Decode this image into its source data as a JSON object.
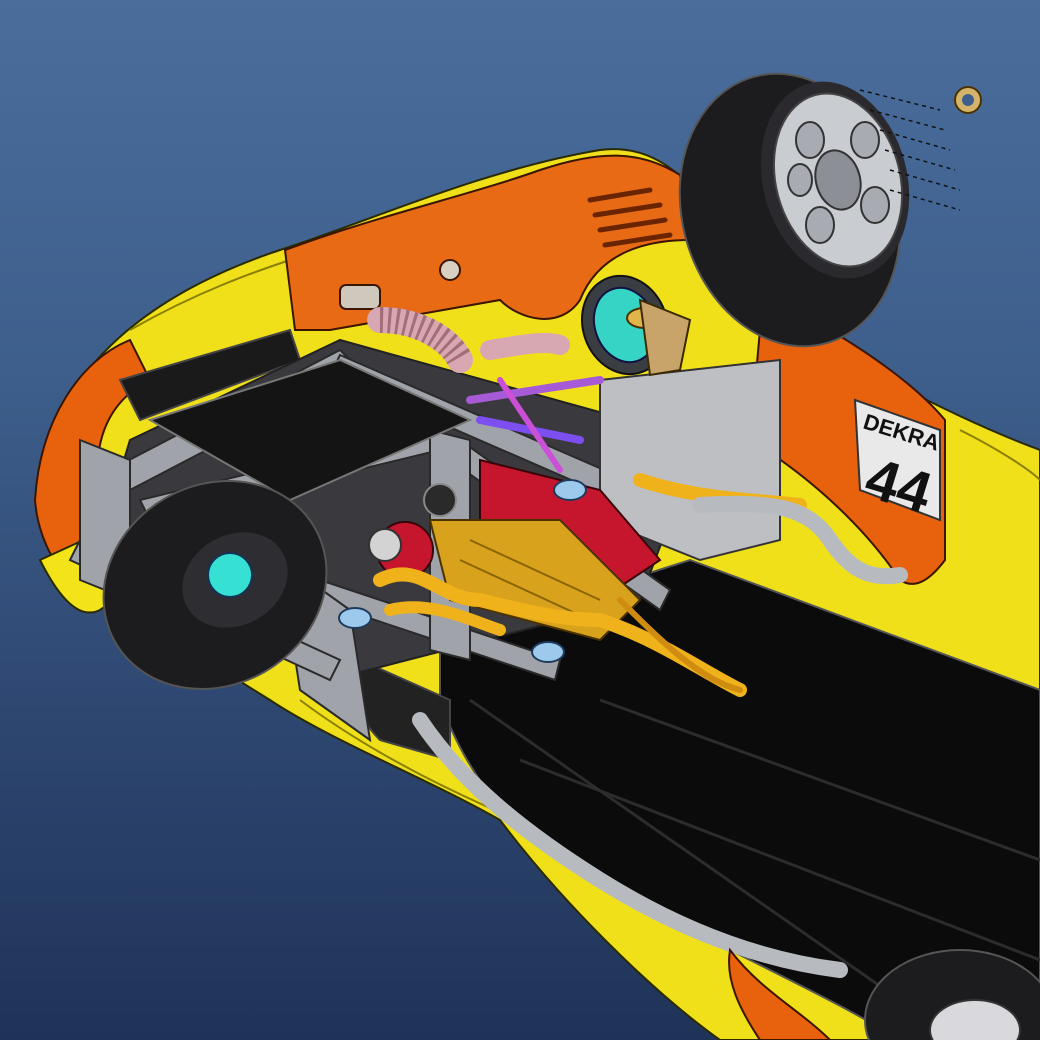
{
  "viewport": {
    "background_top": "#4a6d9c",
    "background_bottom": "#1f3358"
  },
  "model": {
    "colors": {
      "body_yellow": "#f2e418",
      "body_orange": "#e8620e",
      "tire": "#1c1c1e",
      "frame": "#9a9ea4",
      "floor": "#0b0b0b",
      "exhaust": "#f0b21a",
      "engine_red": "#c5162e",
      "oil_pan": "#d9a21c"
    },
    "decal": {
      "sponsor": "DEKRA",
      "number": "44"
    }
  }
}
